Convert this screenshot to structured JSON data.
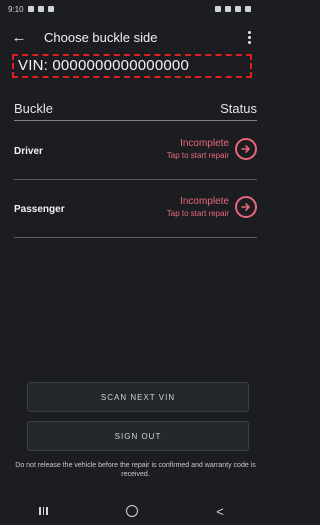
{
  "status_bar": {
    "time": "9:10"
  },
  "app_bar": {
    "back_icon": "arrow-left-icon",
    "title": "Choose buckle side",
    "menu_icon": "more-vert-icon"
  },
  "vin": {
    "text": "VIN: 0000000000000000"
  },
  "table": {
    "col_buckle": "Buckle",
    "col_status": "Status",
    "rows": [
      {
        "name": "Driver",
        "status": "Incomplete",
        "action": "Tap to start repair"
      },
      {
        "name": "Passenger",
        "status": "Incomplete",
        "action": "Tap to start repair"
      }
    ]
  },
  "buttons": {
    "scan_next": "SCAN NEXT VIN",
    "sign_out": "SIGN OUT"
  },
  "warning": "Do not release the vehicle before the repair is confirmed and warranty code is received.",
  "colors": {
    "accent": "#e8687b",
    "highlight": "#e02020",
    "background": "#1b1d21"
  }
}
